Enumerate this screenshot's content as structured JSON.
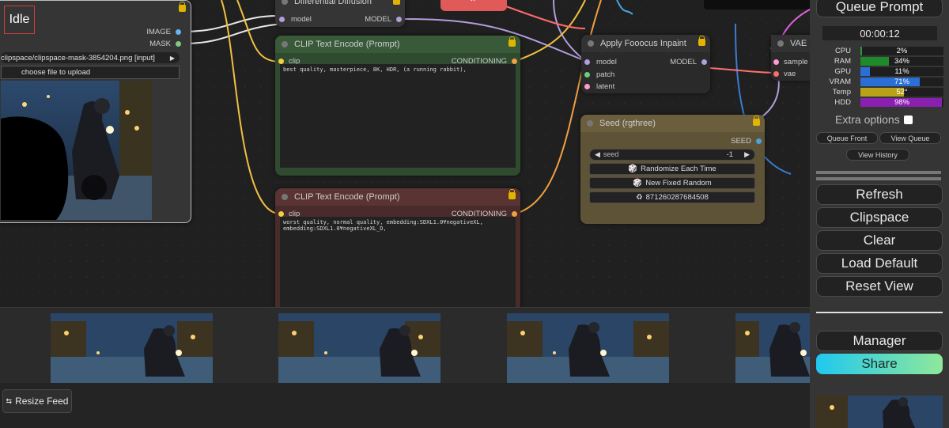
{
  "status": {
    "label": "Idle"
  },
  "load_image_node": {
    "outputs": [
      "IMAGE",
      "MASK"
    ],
    "image_value": "clipspace/clipspace-mask-3854204.png [input]",
    "upload_label": "choose file to upload"
  },
  "diff_diffusion_node": {
    "title": "Differential Diffusion",
    "input": "model",
    "output": "MODEL"
  },
  "clip_pos_node": {
    "title": "CLIP Text Encode (Prompt)",
    "input": "clip",
    "output": "CONDITIONING",
    "text": "best quality, masterpiece, 8K, HDR, (a running rabbit),"
  },
  "clip_neg_node": {
    "title": "CLIP Text Encode (Prompt)",
    "input": "clip",
    "output": "CONDITIONING",
    "text": "worst quality, normal quality, embedding:SDXL1.0¥negativeXL,\nembedding:SDXL1.0¥negativeXL_D,"
  },
  "fooocus_node": {
    "title": "Apply Fooocus Inpaint",
    "inputs": [
      "model",
      "patch",
      "latent"
    ],
    "output": "MODEL"
  },
  "vae_node": {
    "title": "VAE I",
    "inputs": [
      "sample",
      "vae"
    ]
  },
  "seed_node": {
    "title": "Seed (rgthree)",
    "output": "SEED",
    "seed_label": "seed",
    "seed_value": "-1",
    "randomize_label": "Randomize Each Time",
    "fixed_label": "New Fixed Random",
    "last_seed": "871260287684508",
    "randomize_icon": "dice-icon",
    "recycle_icon": "recycle-icon"
  },
  "panel": {
    "queue_prompt": "Queue Prompt",
    "timer": "00:00:12",
    "stats": [
      {
        "label": "CPU",
        "value": "2%",
        "pct": 2,
        "color": "#2e9a3a"
      },
      {
        "label": "RAM",
        "value": "34%",
        "pct": 34,
        "color": "#1f8a2a"
      },
      {
        "label": "GPU",
        "value": "11%",
        "pct": 11,
        "color": "#2a6fd6"
      },
      {
        "label": "VRAM",
        "value": "71%",
        "pct": 71,
        "color": "#2a6fd6"
      },
      {
        "label": "Temp",
        "value": "52°",
        "pct": 52,
        "color": "#b8a21a"
      },
      {
        "label": "HDD",
        "value": "98%",
        "pct": 98,
        "color": "#8a1fb0"
      }
    ],
    "extra_options": "Extra options",
    "queue_front": "Queue Front",
    "view_queue": "View Queue",
    "view_history": "View History",
    "refresh": "Refresh",
    "clipspace": "Clipspace",
    "clear": "Clear",
    "load_default": "Load Default",
    "reset_view": "Reset View",
    "manager": "Manager",
    "share": "Share",
    "share_gradient": [
      "#20c8f0",
      "#8ee89a"
    ]
  },
  "feed": {
    "resize_label": "Resize Feed",
    "resize_icon": "resize-arrows-icon"
  },
  "colors": {
    "clip_pos_bg": "#2f4a2f",
    "clip_neg_bg": "#4a2b2b",
    "seed_bg": "#5e5336",
    "wire_yellow": "#f0c040",
    "wire_purple": "#b39ddb",
    "wire_orange": "#f0a040"
  }
}
